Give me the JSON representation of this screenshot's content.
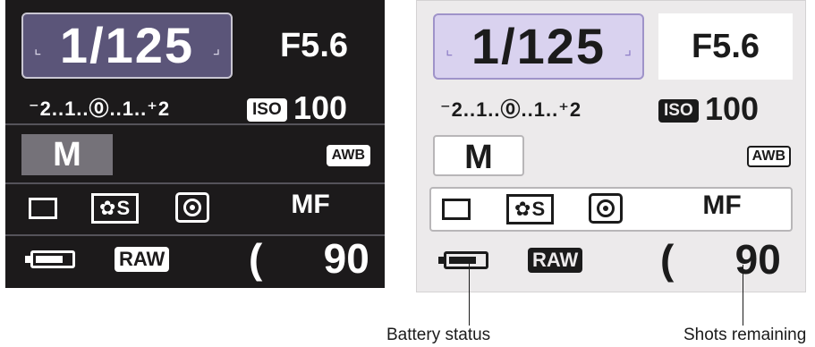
{
  "screens": [
    {
      "theme": "dark",
      "shutter_speed": "1/125",
      "aperture": "F5.6",
      "exposure_scale": "⁻2..1..⓪..1..⁺2",
      "iso_badge": "ISO",
      "iso_value": "100",
      "mode": "M",
      "white_balance": "AWB",
      "picture_style": "S",
      "focus_mode": "MF",
      "quality": "RAW",
      "shots_open": "(",
      "shots_remaining": "90",
      "shots_close": ")",
      "battery_level": 0.8
    },
    {
      "theme": "light",
      "shutter_speed": "1/125",
      "aperture": "F5.6",
      "exposure_scale": "⁻2..1..⓪..1..⁺2",
      "iso_badge": "ISO",
      "iso_value": "100",
      "mode": "M",
      "white_balance": "AWB",
      "picture_style": "S",
      "focus_mode": "MF",
      "quality": "RAW",
      "shots_open": "(",
      "shots_remaining": "90",
      "shots_close": ")",
      "battery_level": 0.8
    }
  ],
  "callouts": {
    "battery": "Battery status",
    "shots": "Shots remaining"
  },
  "icons": {
    "dial_arrows": "dial-arrow-icon",
    "drive": "single-shot-drive-icon",
    "picture_style": "picture-style-icon",
    "metering": "evaluative-metering-icon",
    "battery": "battery-icon"
  },
  "colors": {
    "dark_bg": "#1c1a1b",
    "shutter_highlight_dark": "#5b5579",
    "shutter_highlight_light": "#d9d2ef",
    "light_bg": "#eceaeb"
  }
}
